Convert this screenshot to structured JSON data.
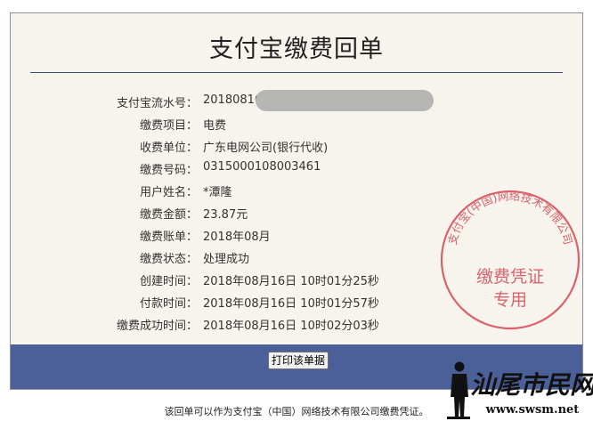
{
  "receipt": {
    "title": "支付宝缴费回单",
    "fields": [
      {
        "label": "支付宝流水号：",
        "value": "20180816"
      },
      {
        "label": "缴费项目：",
        "value": "电费"
      },
      {
        "label": "收费单位：",
        "value": "广东电网公司(银行代收)"
      },
      {
        "label": "缴费号码：",
        "value": "0315000108003461"
      },
      {
        "label": "用户姓名：",
        "value": "*潭隆"
      },
      {
        "label": "缴费金额：",
        "value": "23.87元"
      },
      {
        "label": "缴费账单：",
        "value": "2018年08月"
      },
      {
        "label": "缴费状态：",
        "value": "处理成功"
      },
      {
        "label": "创建时间：",
        "value": "2018年08月16日 10时01分25秒"
      },
      {
        "label": "付款时间：",
        "value": "2018年08月16日 10时01分57秒"
      },
      {
        "label": "缴费成功时间：",
        "value": "2018年08月16日 10时02分03秒"
      }
    ],
    "print_button": "打印该单据",
    "footer_note": "该回单可以作为支付宝（中国）网络技术有限公司缴费凭证。"
  },
  "stamp": {
    "ring_text": "支付宝(中国)网络技术有限公司",
    "line1": "缴费凭证",
    "line2": "专用",
    "color": "#d9626d"
  },
  "watermark": {
    "brand": "汕尾市民网",
    "url": "www.swsm.net"
  },
  "colors": {
    "bar": "#4b5f99",
    "paper": "#f6f4ec",
    "rule": "#3d4b6e"
  }
}
